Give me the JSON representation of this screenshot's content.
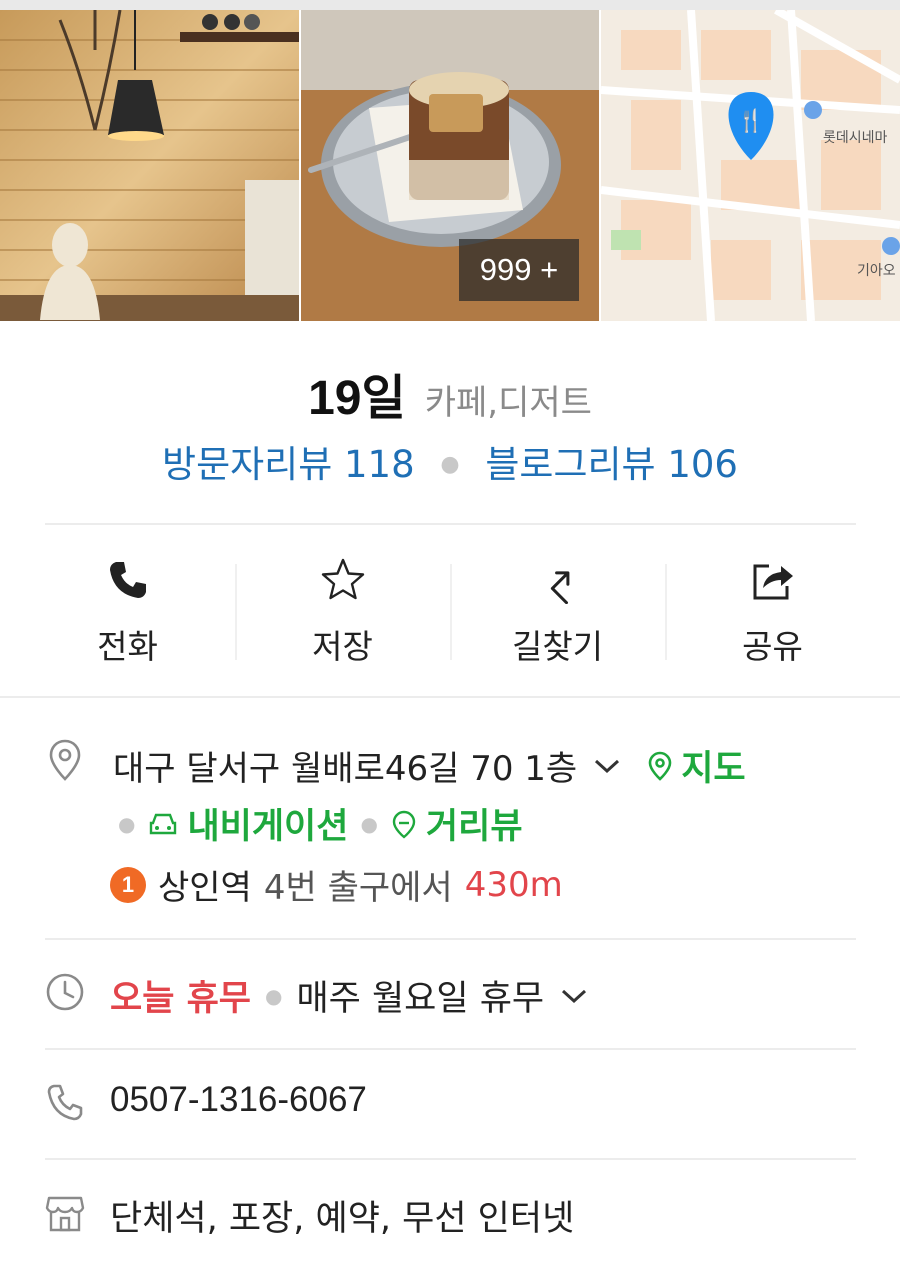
{
  "gallery": {
    "photo_count_badge": "999 +",
    "map_labels": [
      "롯데시네마",
      "기아오"
    ],
    "map_pin_icon": "restaurant-pin-icon"
  },
  "place": {
    "name": "19일",
    "category": "카페,디저트",
    "visitor_reviews": "방문자리뷰 118",
    "blog_reviews": "블로그리뷰 106"
  },
  "actions": [
    {
      "label": "전화",
      "icon": "phone-icon"
    },
    {
      "label": "저장",
      "icon": "star-icon"
    },
    {
      "label": "길찾기",
      "icon": "directions-icon"
    },
    {
      "label": "공유",
      "icon": "share-icon"
    }
  ],
  "address": {
    "text": "대구 달서구 월배로46길 70 1층",
    "map_link": "지도",
    "navigation_link": "내비게이션",
    "streetview_link": "거리뷰"
  },
  "subway": {
    "line_number": "1",
    "station": "상인역",
    "exit_text": "4번 출구에서",
    "distance": "430m"
  },
  "hours": {
    "today_status": "오늘 휴무",
    "weekly": "매주 월요일 휴무"
  },
  "phone": "0507-1316-6067",
  "facilities": "단체석, 포장, 예약, 무선 인터넷",
  "colors": {
    "link_blue": "#1f6fb5",
    "green": "#1ea83d",
    "red": "#e2454b",
    "subway_line1": "#f06a25"
  }
}
